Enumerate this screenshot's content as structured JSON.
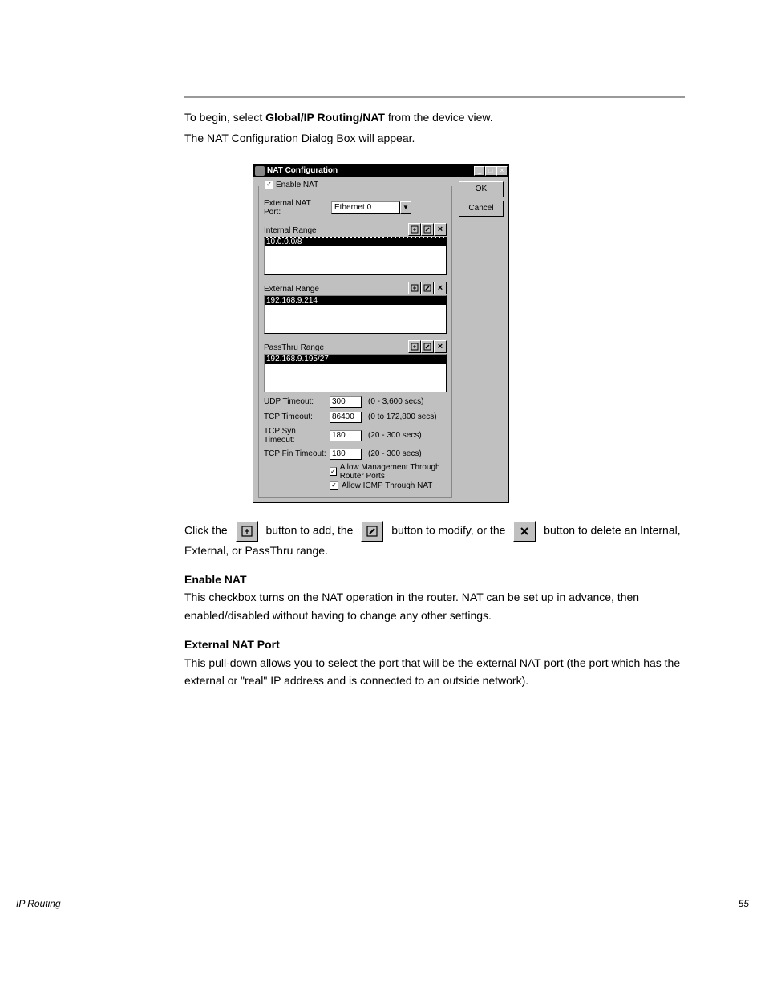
{
  "intro": {
    "line1_prefix": "To begin, select ",
    "line1_strong": "Global/IP Routing/NAT",
    "line1_suffix": " from the device view.",
    "line2": "The NAT Configuration Dialog Box will appear."
  },
  "dialog": {
    "title": "NAT Configuration",
    "enable_label": "Enable NAT",
    "external_port_label": "External NAT Port:",
    "external_port_value": "Ethernet 0",
    "sections": {
      "internal": {
        "label": "Internal Range",
        "item": "10.0.0.0/8"
      },
      "external": {
        "label": "External Range",
        "item": "192.168.9.214"
      },
      "passthru": {
        "label": "PassThru Range",
        "item": "192.168.9.195/27"
      }
    },
    "timeouts": {
      "udp": {
        "label": "UDP Timeout:",
        "value": "300",
        "hint": "(0 - 3,600 secs)"
      },
      "tcp": {
        "label": "TCP Timeout:",
        "value": "86400",
        "hint": "(0 to 172,800 secs)"
      },
      "syn": {
        "label": "TCP Syn Timeout:",
        "value": "180",
        "hint": "(20 - 300 secs)"
      },
      "fin": {
        "label": "TCP Fin Timeout:",
        "value": "180",
        "hint": "(20 - 300 secs)"
      }
    },
    "allow_mgmt": "Allow Management Through Router Ports",
    "allow_icmp": "Allow ICMP Through NAT",
    "ok": "OK",
    "cancel": "Cancel"
  },
  "post": {
    "p1_prefix": "Click the ",
    "p1_mid1": " button to add, the ",
    "p1_mid2": " button to modify, or the ",
    "p1_suffix": " button to delete an Internal, External, or PassThru range.",
    "p2_strong": "Enable NAT",
    "p2_body": "This checkbox turns on the NAT operation in the router. NAT can be set up in advance, then enabled/disabled without having to change any other settings.",
    "p3_strong": "External NAT Port",
    "p3_body": "This pull-down allows you to select the port that will be the external NAT port (the port which has the external or \"real\" IP address and is connected to an outside network)."
  },
  "footer": {
    "left": "IP Routing",
    "right": "55"
  }
}
